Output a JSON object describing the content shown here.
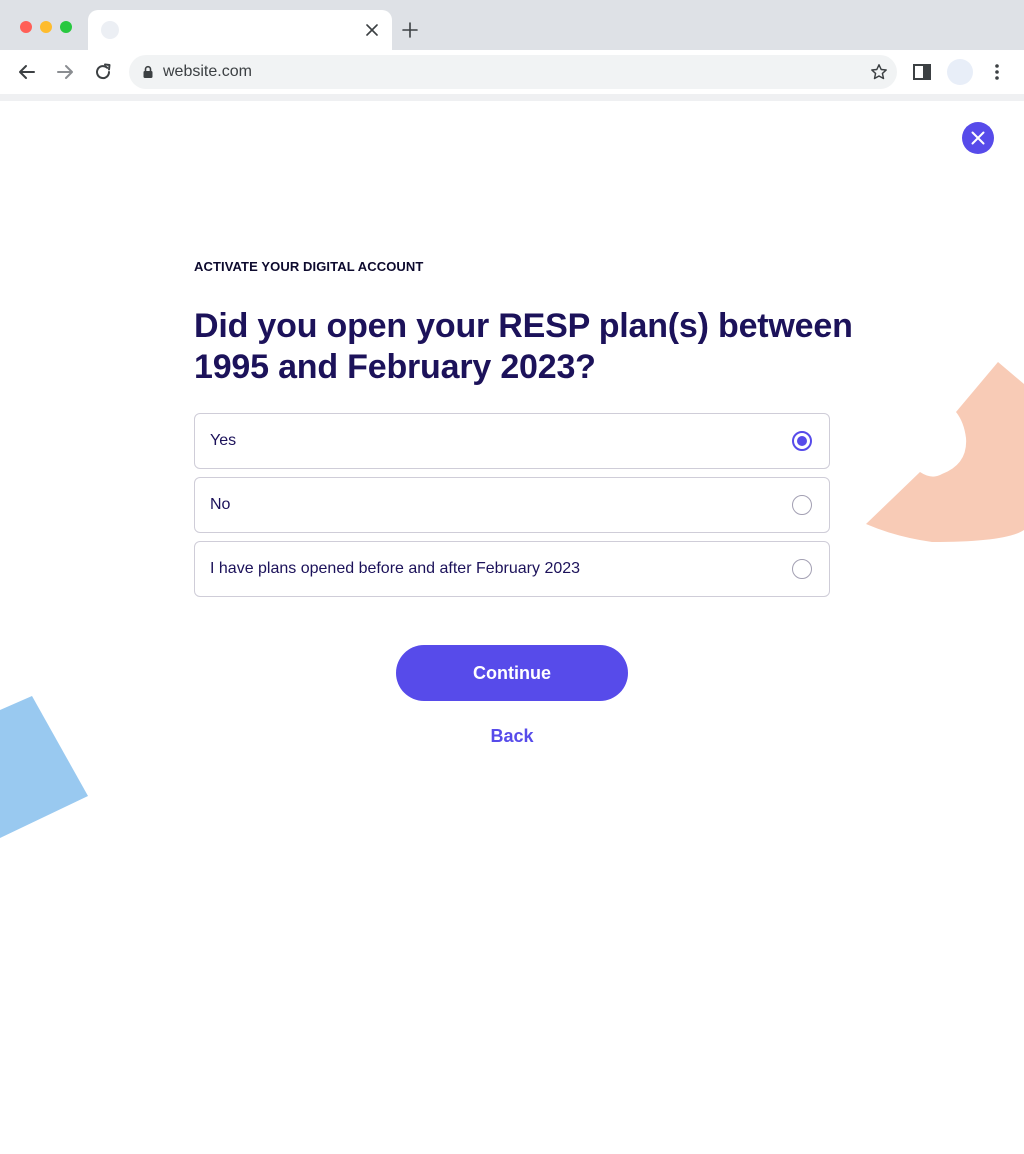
{
  "browser": {
    "tab_title": "",
    "url": "website.com"
  },
  "page": {
    "eyebrow": "ACTIVATE YOUR DIGITAL ACCOUNT",
    "question": "Did you open your RESP plan(s) between 1995 and February 2023?",
    "options": [
      {
        "label": "Yes",
        "selected": true
      },
      {
        "label": "No",
        "selected": false
      },
      {
        "label": "I have plans opened before and after February 2023",
        "selected": false
      }
    ],
    "continue_label": "Continue",
    "back_label": "Back"
  },
  "colors": {
    "accent": "#574bea",
    "heading": "#1c125a",
    "peach_shape": "#f8cbb6",
    "blue_shape": "#99c9f0"
  },
  "icons": {
    "close": "close-icon",
    "back": "arrow-left-icon",
    "forward": "arrow-right-icon",
    "reload": "reload-icon",
    "lock": "lock-icon",
    "bookmark": "star-icon",
    "side_panel": "side-panel-icon",
    "menu": "kebab-menu-icon"
  }
}
